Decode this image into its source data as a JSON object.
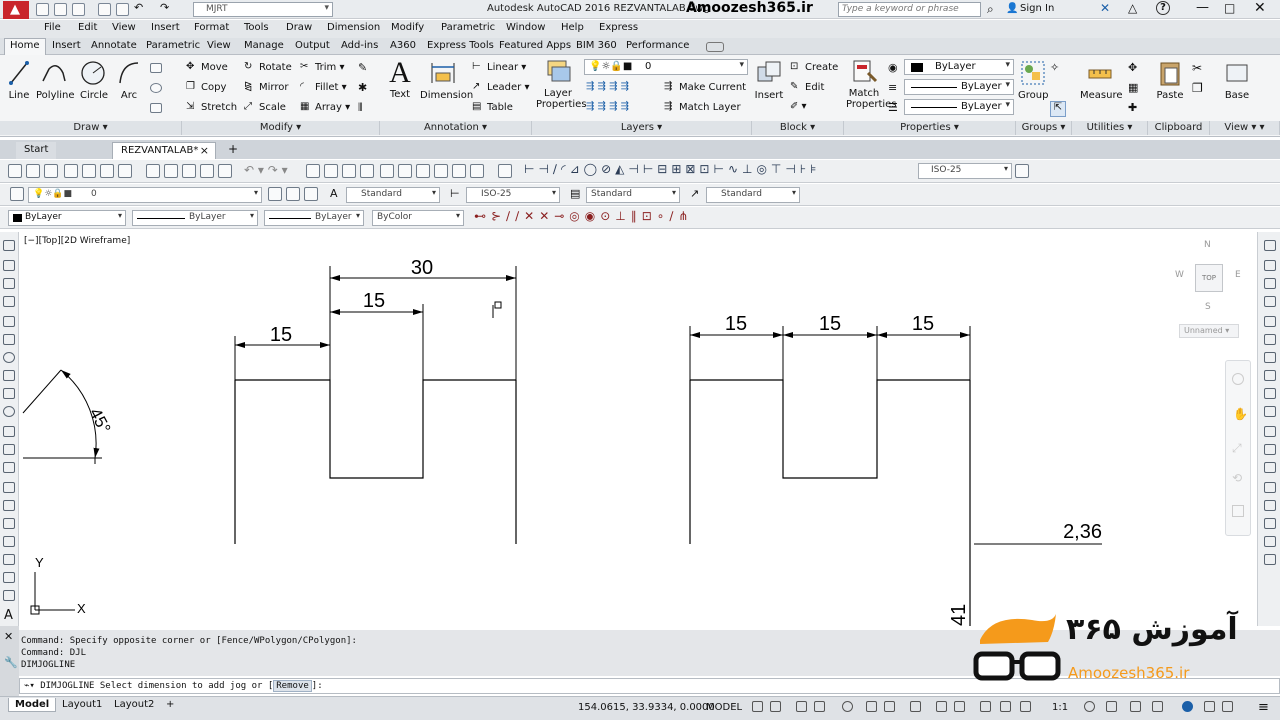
{
  "app": {
    "title": "Autodesk AutoCAD 2016    REZVANTALAB.dwg",
    "watermark": "Amoozesh365.ir"
  },
  "titlebar": {
    "workspace": "MJRT",
    "search_placeholder": "Type a keyword or phrase",
    "sign_in": "Sign In",
    "help": "?"
  },
  "menu": [
    "File",
    "Edit",
    "View",
    "Insert",
    "Format",
    "Tools",
    "Draw",
    "Dimension",
    "Modify",
    "Parametric",
    "Window",
    "Help",
    "Express"
  ],
  "ribbon_tabs": [
    "Home",
    "Insert",
    "Annotate",
    "Parametric",
    "View",
    "Manage",
    "Output",
    "Add-ins",
    "A360",
    "Express Tools",
    "Featured Apps",
    "BIM 360",
    "Performance"
  ],
  "ribbon": {
    "draw": {
      "title": "Draw",
      "line": "Line",
      "polyline": "Polyline",
      "circle": "Circle",
      "arc": "Arc"
    },
    "modify": {
      "title": "Modify",
      "move": "Move",
      "rotate": "Rotate",
      "trim": "Trim",
      "copy": "Copy",
      "mirror": "Mirror",
      "fillet": "Fillet",
      "stretch": "Stretch",
      "scale": "Scale",
      "array": "Array"
    },
    "annotation": {
      "title": "Annotation",
      "text": "Text",
      "dimension": "Dimension",
      "linear": "Linear",
      "leader": "Leader",
      "table": "Table"
    },
    "layers": {
      "title": "Layers",
      "layer_properties_1": "Layer",
      "layer_properties_2": "Properties",
      "current_layer": "0",
      "make_current": "Make Current",
      "match_layer": "Match Layer"
    },
    "block": {
      "title": "Block",
      "insert": "Insert",
      "create": "Create",
      "edit": "Edit"
    },
    "properties": {
      "title": "Properties",
      "match_1": "Match",
      "match_2": "Properties",
      "color": "ByLayer",
      "linetype": "ByLayer",
      "lineweight": "ByLayer"
    },
    "groups": {
      "title": "Groups",
      "group": "Group"
    },
    "utilities": {
      "title": "Utilities",
      "measure": "Measure"
    },
    "clipboard": {
      "title": "Clipboard",
      "paste": "Paste"
    },
    "view": {
      "title": "View",
      "base": "Base"
    }
  },
  "doc_tabs": {
    "start": "Start",
    "file": "REZVANTALAB*",
    "add": "+"
  },
  "toolbars": {
    "layer_value": "0",
    "text_style": "Standard",
    "dim_style": "ISO-25",
    "dim_style_right": "ISO-25",
    "table_style": "Standard",
    "mleader_style": "Standard",
    "color": "ByLayer",
    "linetype": "ByLayer",
    "lineweight": "ByLayer",
    "plotstyle": "ByColor"
  },
  "viewport": {
    "label": "[−][Top][2D Wireframe]",
    "viewcube_top": "TOP",
    "viewcube_north": "N",
    "viewcube_west": "W",
    "viewcube_east": "E",
    "viewcube_south": "S",
    "ucs_name": "Unnamed",
    "axis_x": "X",
    "axis_y": "Y"
  },
  "dims": {
    "d30": "30",
    "d15_top": "15",
    "d15_left": "15",
    "d15_a": "15",
    "d15_b": "15",
    "d15_c": "15",
    "angle": "45°",
    "jog_value": "2,36",
    "vertical": "41"
  },
  "command": {
    "history": [
      "Command: Specify opposite corner or [Fence/WPolygon/CPolygon]:",
      "Command: DJL",
      "DIMJOGLINE"
    ],
    "prompt_prefix": "DIMJOGLINE Select dimension to add jog or [",
    "prompt_option": "Remove",
    "prompt_suffix": "]:"
  },
  "logo": {
    "persian": "آموزش ۳۶۵",
    "url": "Amoozesh365.ir"
  },
  "status": {
    "tabs": [
      "Model",
      "Layout1",
      "Layout2"
    ],
    "add": "+",
    "coords": "154.0615, 33.9334, 0.0000",
    "space": "MODEL",
    "scale": "1:1"
  },
  "colors": {
    "accent": "#1b5fa8",
    "logo_orange": "#f59a1b"
  }
}
